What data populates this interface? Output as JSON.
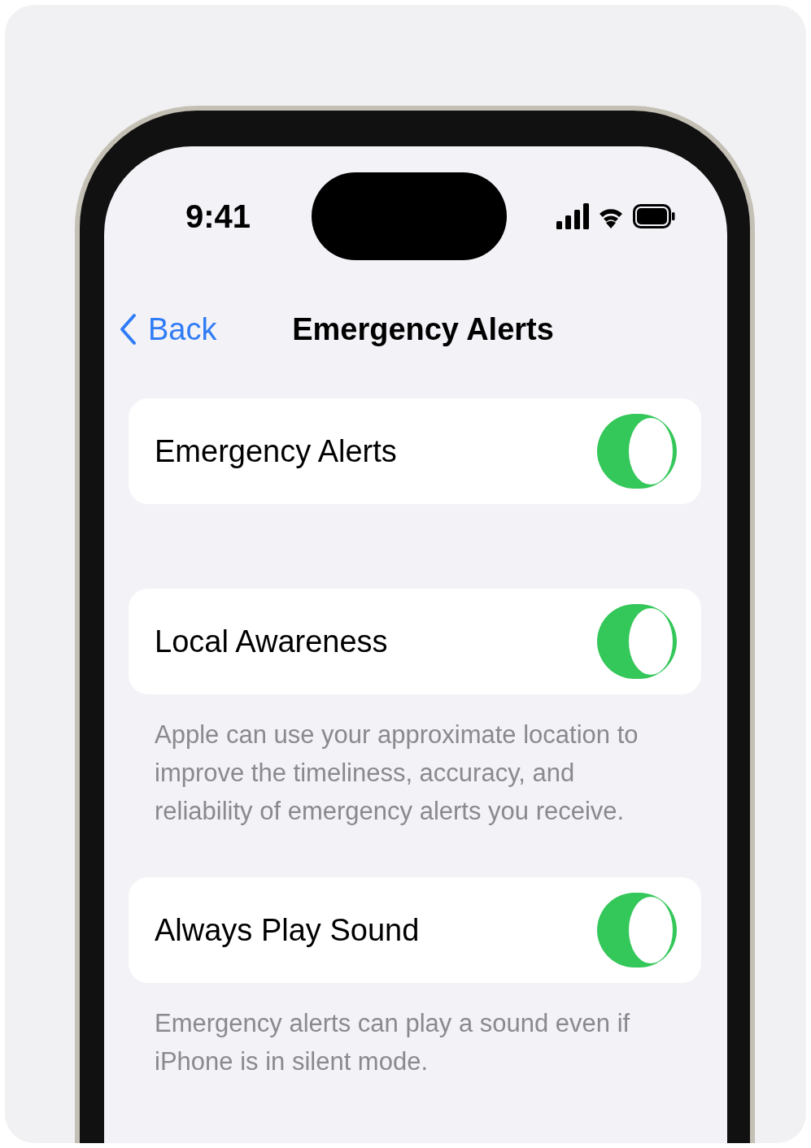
{
  "status_bar": {
    "time": "9:41"
  },
  "nav": {
    "back": "Back",
    "title": "Emergency Alerts"
  },
  "settings": [
    {
      "label": "Emergency Alerts",
      "on": true
    },
    {
      "label": "Local Awareness",
      "on": true,
      "footer": "Apple can use your approximate location to improve the timeliness, accuracy, and reliability of emergency alerts you receive."
    },
    {
      "label": "Always Play Sound",
      "on": true,
      "footer": "Emergency alerts can play a sound even if iPhone is in silent mode."
    }
  ]
}
